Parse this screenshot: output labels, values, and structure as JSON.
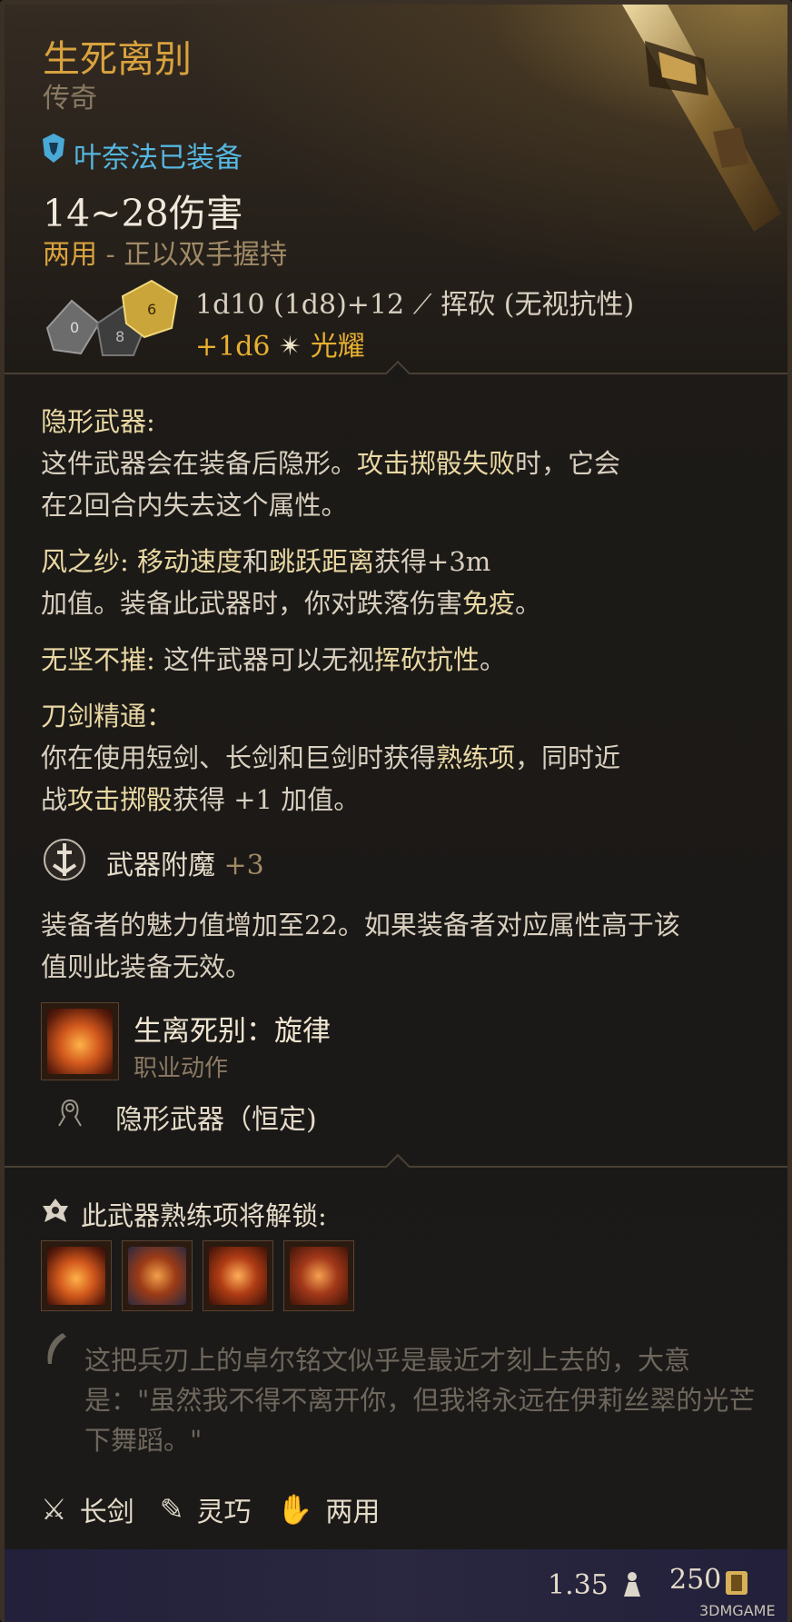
{
  "item": {
    "name": "生死离别",
    "rarity": "传奇",
    "equipped_by": "叶奈法已装备",
    "damage": "14~28伤害",
    "handedness_main": "两用",
    "handedness_sub": " - 正以双手握持",
    "damage_dice": "1d10 (1d8)+12",
    "damage_type": "挥砍 (无视抗性)",
    "bonus_dice": "+1d6",
    "bonus_type": "光耀"
  },
  "properties": [
    {
      "name": "隐形武器:",
      "line1": "这件武器会在装备后隐形。",
      "line1_hl": "攻击掷骰失败",
      "line1_end": "时，它会",
      "line2": "在2回合内失去这个属性。"
    },
    {
      "name": "风之纱: ",
      "hl1": "移动速度",
      "t1": "和",
      "hl2": "跳跃距离",
      "t2": "获得+3m",
      "line2": "加值。装备此武器时，你对跌落伤害",
      "line2_hl": "免疫",
      "line2_end": "。"
    },
    {
      "name": "无坚不摧: ",
      "t1": "这件武器可以无视",
      "hl1": "挥砍",
      "hl2": "抗性",
      "t2": "。"
    },
    {
      "name": "刀剑精通：",
      "line1": "你在使用短剑、长剑和巨剑时获得",
      "line1_hl": "熟练项",
      "line1_end": "，同时近",
      "line2a": "战",
      "line2_hl": "攻击掷骰",
      "line2_end": "获得 +1 加值。"
    }
  ],
  "enchant": {
    "label": "武器附魔",
    "value": "+3"
  },
  "charisma": {
    "line1": "装备者的魅力值增加至22。如果装备者对应属性高于该",
    "line2": "值则此装备无效。"
  },
  "action": {
    "name": "生离死别：旋律",
    "type": "职业动作"
  },
  "passive": {
    "name": "隐形武器（恒定)"
  },
  "proficiency": {
    "label": "此武器熟练项将解锁:"
  },
  "lore": "这把兵刃上的卓尔铭文似乎是最近才刻上去的，大意是：\"虽然我不得不离开你，但我将永远在伊莉丝翠的光芒下舞蹈。\"",
  "tags": [
    "长剑",
    "灵巧",
    "两用"
  ],
  "footer": {
    "weight": "1.35",
    "price": "250"
  },
  "watermark": "3DMGAME",
  "colors": {
    "title": "#d9a23e",
    "equipped": "#55b7e0",
    "radiant": "#e8b030"
  }
}
